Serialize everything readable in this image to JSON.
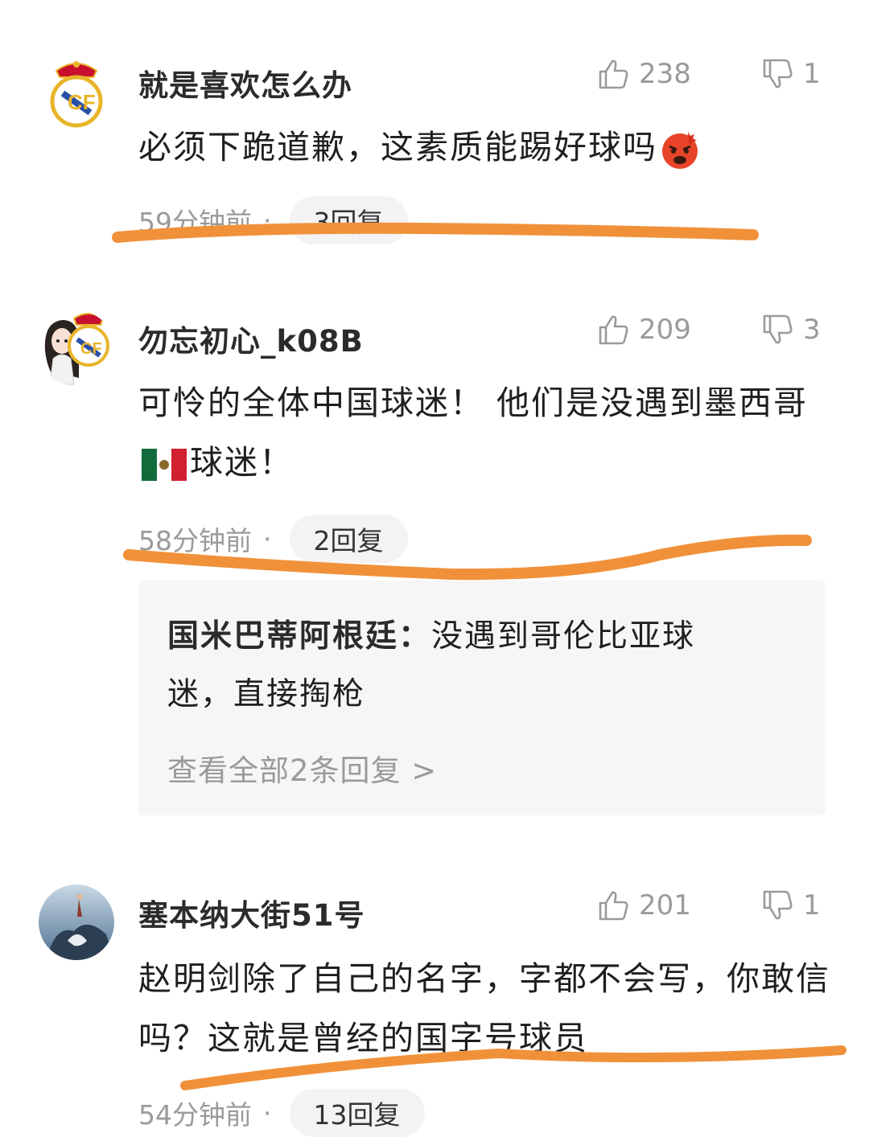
{
  "comments": [
    {
      "username": "就是喜欢怎么办",
      "likes": "238",
      "dislikes": "1",
      "content": "必须下跪道歉，这素质能踢好球吗",
      "time": "59分钟前",
      "dot": "·",
      "replies": "3回复",
      "emoji": "angry-face-icon"
    },
    {
      "username": "勿忘初心_k08B",
      "likes": "209",
      "dislikes": "3",
      "content_part1": "可怜的全体中国球迷！ 他们是没遇到墨西哥",
      "content_part2": "球迷！",
      "time": "58分钟前",
      "dot": "·",
      "replies": "2回复",
      "emoji": "mexico-flag-icon",
      "reply_preview": {
        "author": "国米巴蒂阿根廷：",
        "text": "没遇到哥伦比亚球迷，直接掏枪",
        "view_all": "查看全部2条回复 >"
      }
    },
    {
      "username": "塞本纳大街51号",
      "likes": "201",
      "dislikes": "1",
      "content": "赵明剑除了自己的名字，字都不会写，你敢信吗？这就是曾经的国字号球员",
      "time": "54分钟前",
      "dot": "·",
      "replies": "13回复"
    }
  ],
  "colors": {
    "annotation_orange": "#f0913a",
    "muted_text": "#9a9a9a",
    "reply_bg": "#f6f6f6"
  }
}
